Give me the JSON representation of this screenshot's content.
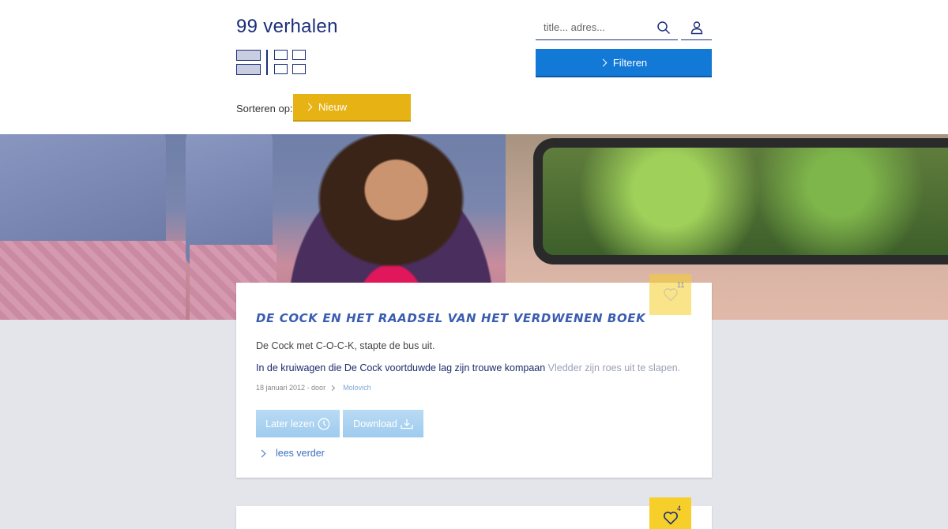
{
  "header": {
    "title": "99 verhalen",
    "sort_label": "Sorteren op:",
    "sort_value": "Nieuw",
    "search_placeholder": "title... adres...",
    "filter_label": "Filteren"
  },
  "stories": [
    {
      "title": "De Cock en het raadsel van het verdwenen boek",
      "likes": "11",
      "intro": "De Cock met C-O-C-K, stapte de bus uit.",
      "excerpt_main": "In de kruiwagen die De Cock voortduwde lag zijn trouwe kompaan ",
      "excerpt_fade": "Vledder zijn roes uit te slapen.",
      "date": "18 januari 2012 - door",
      "author": "Molovich",
      "later_label": "Later lezen",
      "download_label": "Download",
      "read_more_label": "lees verder"
    },
    {
      "likes": "4"
    }
  ],
  "colors": {
    "brand_blue": "#1279d6",
    "accent_yellow": "#e6b214",
    "like_yellow": "#f7cf2a",
    "navy_text": "#1b2f7a"
  },
  "icons": [
    "search-icon",
    "user-icon",
    "heart-icon",
    "clock-icon",
    "download-icon",
    "chevron-right-icon",
    "list-view-icon",
    "grid-view-icon"
  ]
}
